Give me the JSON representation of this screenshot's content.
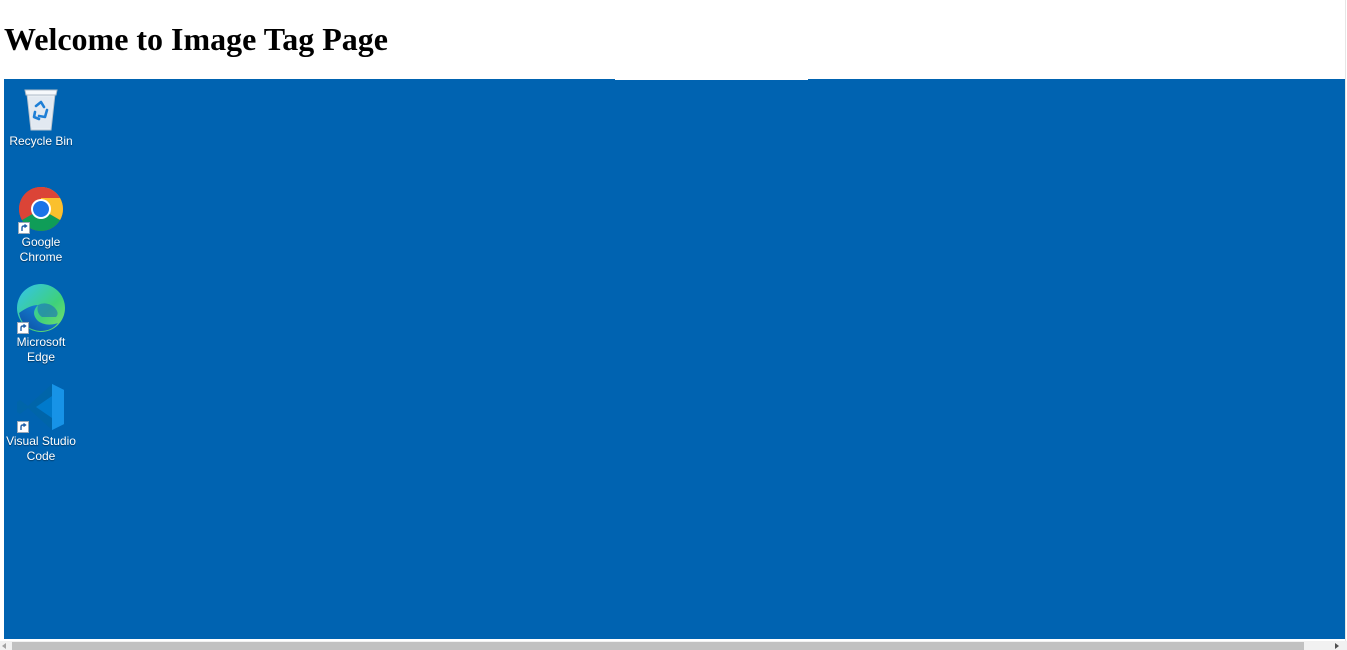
{
  "page": {
    "heading": "Welcome to Image Tag Page"
  },
  "desktop": {
    "background_color": "#0063B1",
    "icons": [
      {
        "name": "recycle-bin-icon",
        "label": "Recycle Bin"
      },
      {
        "name": "google-chrome-icon",
        "label": "Google\nChrome"
      },
      {
        "name": "microsoft-edge-icon",
        "label": "Microsoft\nEdge"
      },
      {
        "name": "visual-studio-code-icon",
        "label": "Visual Studio\nCode"
      }
    ]
  },
  "scrollbar": {
    "orientation": "horizontal"
  }
}
